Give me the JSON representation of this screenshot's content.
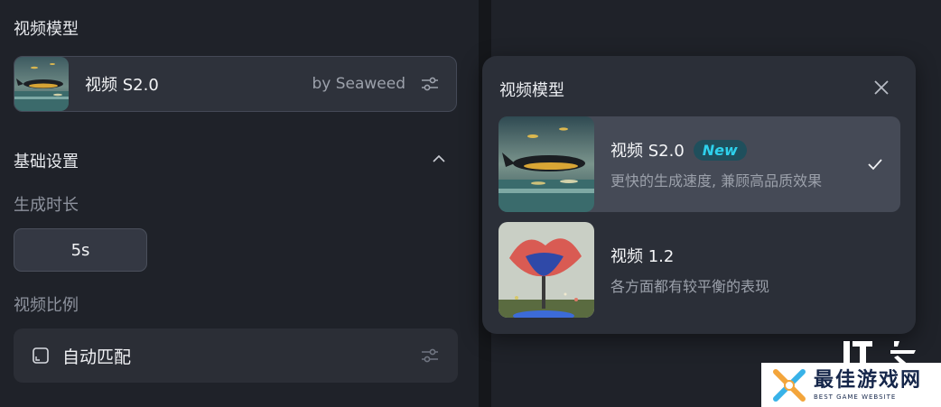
{
  "left_panel": {
    "video_model_heading": "视频模型",
    "model_card": {
      "name": "视频 S2.0",
      "by": "by Seaweed"
    },
    "basic_settings_heading": "基础设置",
    "duration_label": "生成时长",
    "duration_value": "5s",
    "ratio_label": "视频比例",
    "ratio_value": "自动匹配"
  },
  "popup": {
    "title": "视频模型",
    "options": [
      {
        "name": "视频 S2.0",
        "badge": "New",
        "desc": "更快的生成速度, 兼顾高品质效果",
        "selected": true
      },
      {
        "name": "视频 1.2",
        "desc": "各方面都有较平衡的表现",
        "selected": false
      }
    ]
  },
  "watermark": {
    "logo_text": "IT之家",
    "title": "最佳游戏网",
    "subtitle": "BEST GAME WEBSITE"
  },
  "colors": {
    "background": "#1f2229",
    "popup_bg": "#2b2f38",
    "selected_bg": "#454a56",
    "badge_text": "#2ed1ec",
    "badge_bg": "#1f4f5c"
  },
  "icons": [
    "sliders-icon",
    "chevron-up-icon",
    "close-icon",
    "check-icon",
    "aspect-ratio-icon"
  ]
}
